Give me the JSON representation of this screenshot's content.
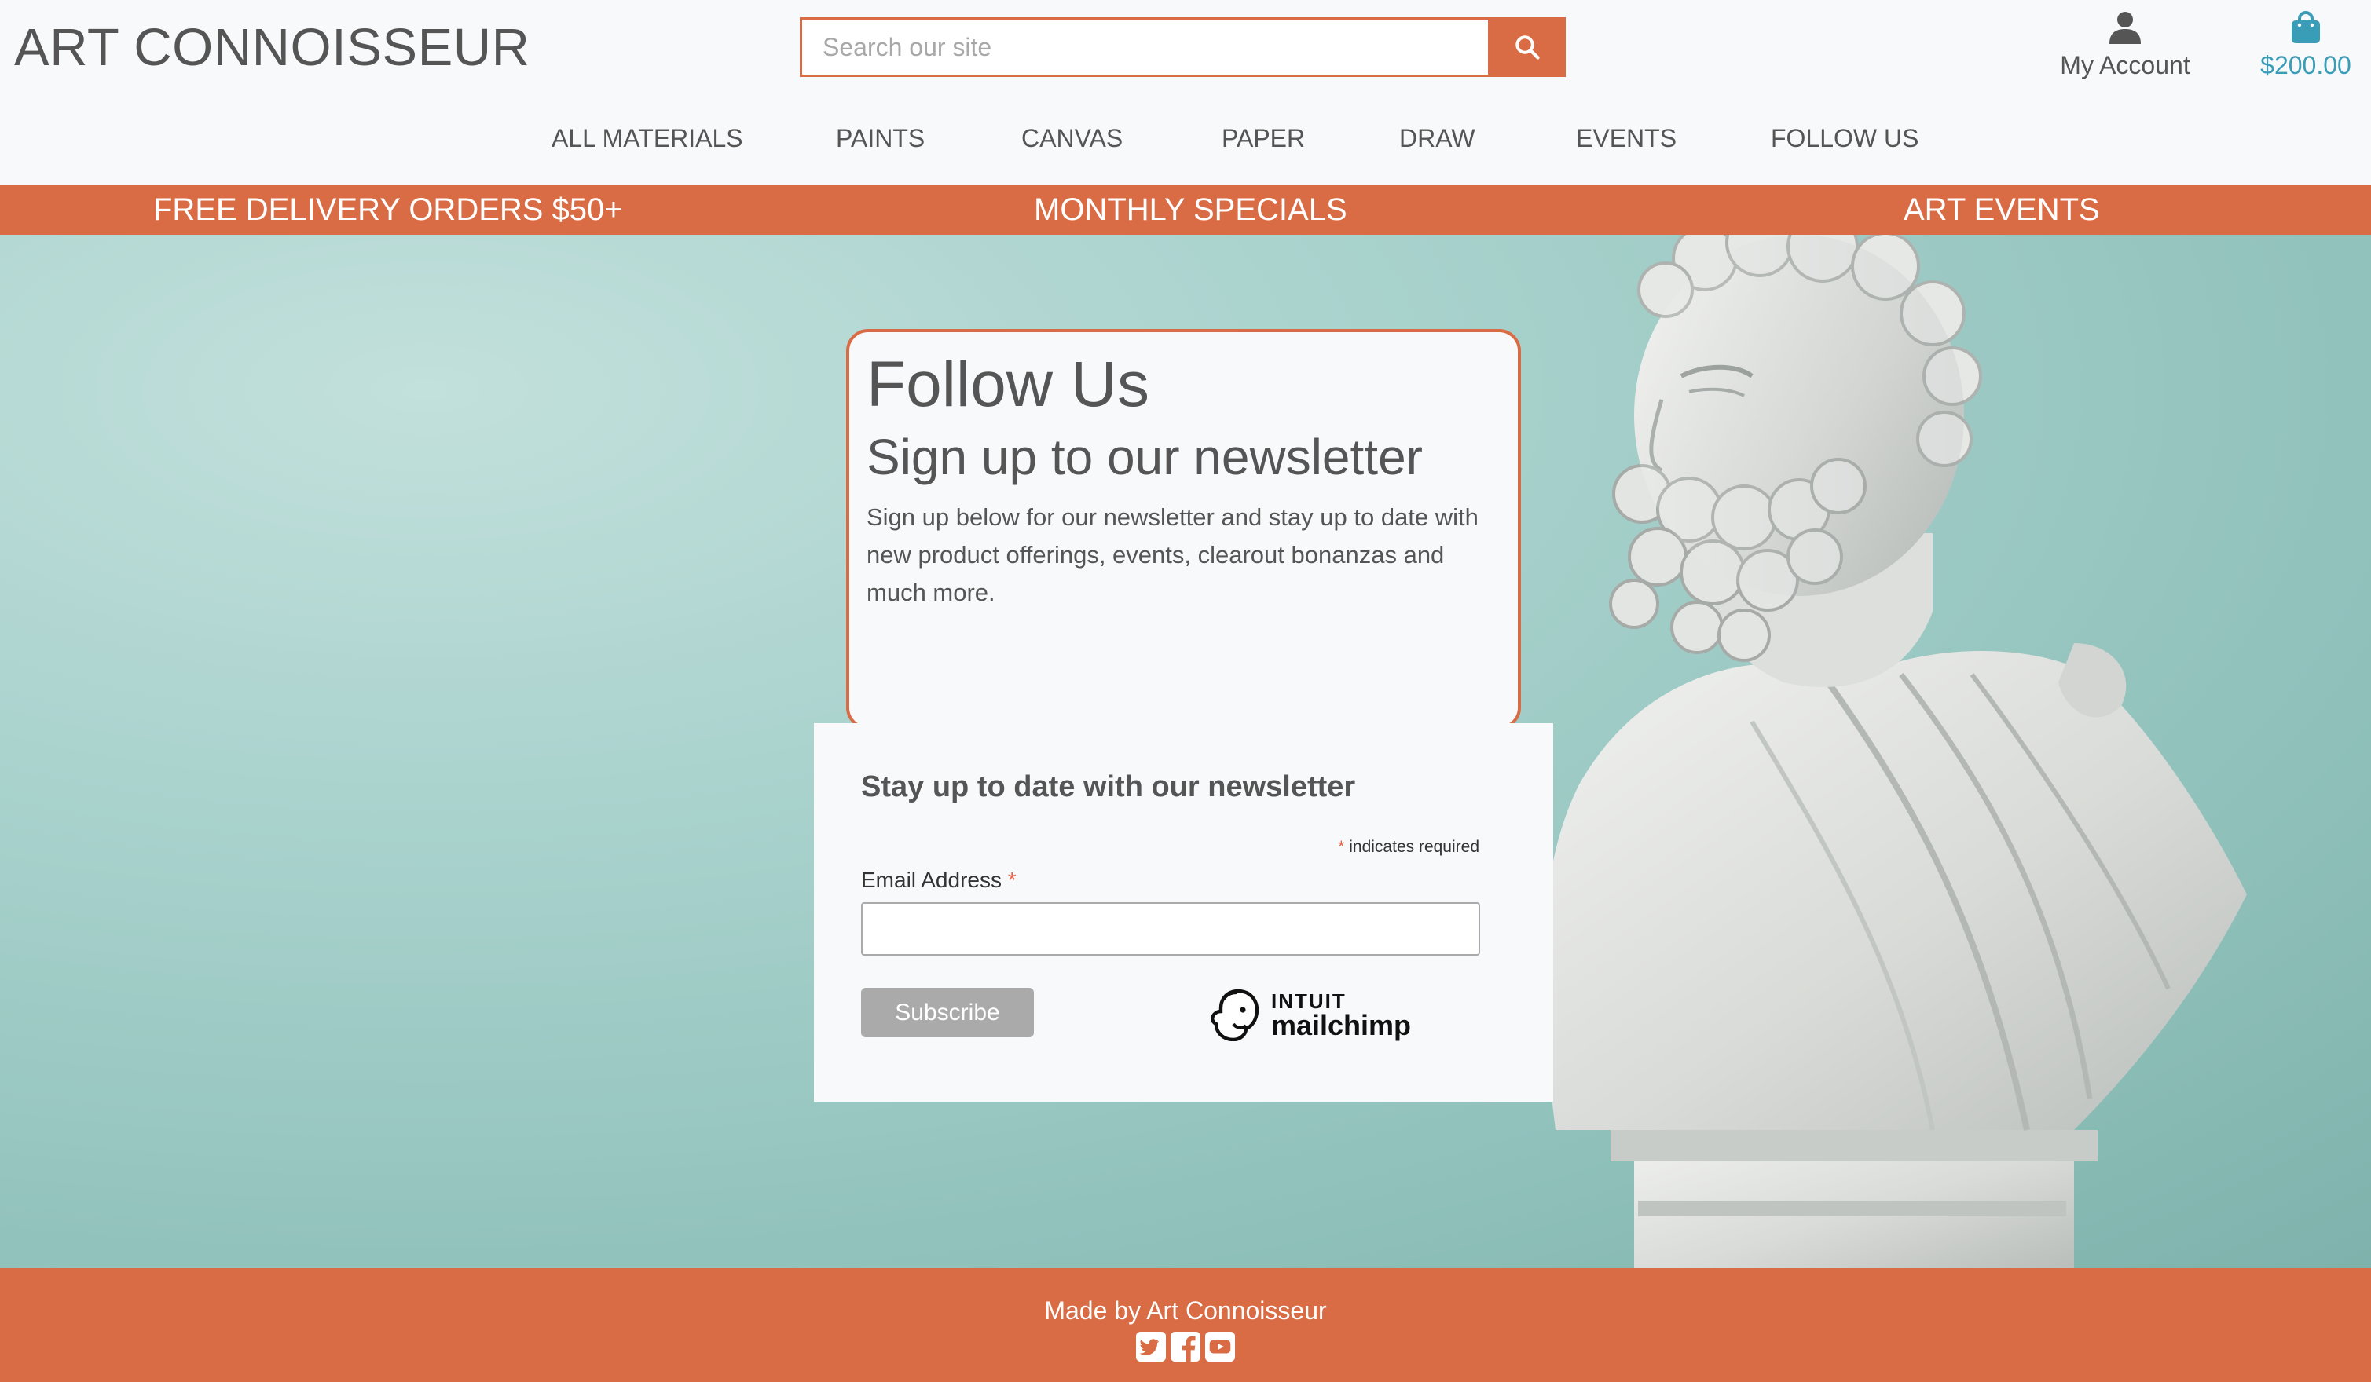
{
  "header": {
    "logo": "ART CONNOISSEUR",
    "search_placeholder": "Search our site",
    "account_label": "My Account",
    "bag_total": "$200.00"
  },
  "nav": {
    "items": [
      {
        "label": "ALL MATERIALS"
      },
      {
        "label": "PAINTS"
      },
      {
        "label": "CANVAS"
      },
      {
        "label": "PAPER"
      },
      {
        "label": "DRAW"
      },
      {
        "label": "EVENTS"
      },
      {
        "label": "FOLLOW US"
      }
    ]
  },
  "promo": {
    "left": "FREE DELIVERY ORDERS $50+",
    "center": "MONTHLY SPECIALS",
    "right": "ART EVENTS"
  },
  "card": {
    "title": "Follow Us",
    "subtitle": "Sign up to our newsletter",
    "text": "Sign up below for our newsletter and stay up to date with new product offerings, events, clearout bonanzas and much more."
  },
  "newsletter": {
    "title": "Stay up to date with our newsletter",
    "required_asterisk": "*",
    "required_note": "indicates required",
    "email_label": "Email Address",
    "submit_label": "Subscribe",
    "brand_top": "INTUIT",
    "brand_main": "mailchimp"
  },
  "footer": {
    "text": "Made by Art Connoisseur",
    "socials": [
      "twitter-icon",
      "facebook-icon",
      "youtube-icon"
    ]
  },
  "colors": {
    "accent": "#d96c44",
    "bag_total": "#3a9db7",
    "hero_bg": "#a9d2cd",
    "text": "#555555"
  }
}
